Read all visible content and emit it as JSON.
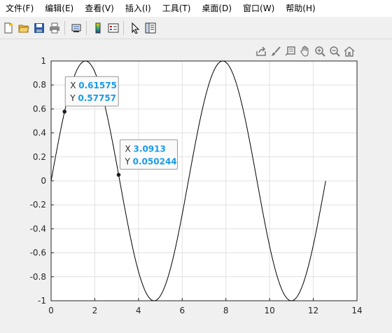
{
  "menu": {
    "items": [
      "文件(F)",
      "编辑(E)",
      "查看(V)",
      "插入(I)",
      "工具(T)",
      "桌面(D)",
      "窗口(W)",
      "帮助(H)"
    ]
  },
  "toolbar": {
    "buttons": [
      "new-file-icon",
      "open-folder-icon",
      "save-icon",
      "print-icon",
      "link-plot-icon",
      "colorbar-icon",
      "legend-icon",
      "pointer-icon",
      "property-inspector-icon"
    ]
  },
  "axes_toolbar": {
    "buttons": [
      "export-icon",
      "brush-icon",
      "data-tips-icon",
      "pan-icon",
      "zoom-in-icon",
      "zoom-out-icon",
      "home-icon"
    ]
  },
  "chart_data": {
    "type": "line",
    "function": "sin(x)",
    "x_range": [
      0,
      12.566
    ],
    "xlim": [
      0,
      14
    ],
    "ylim": [
      -1,
      1
    ],
    "xticks": [
      "0",
      "2",
      "4",
      "6",
      "8",
      "10",
      "12",
      "14"
    ],
    "yticks": [
      "1",
      "0.8",
      "0.6",
      "0.4",
      "0.2",
      "0",
      "-0.2",
      "-0.4",
      "-0.6",
      "-0.8",
      "-1"
    ],
    "grid": true,
    "line_color": "#000000",
    "datatips": [
      {
        "x_label": "X",
        "x_value": "0.61575",
        "y_label": "Y",
        "y_value": "0.57757",
        "x": 0.61575,
        "y": 0.57757
      },
      {
        "x_label": "X",
        "x_value": "3.0913",
        "y_label": "Y",
        "y_value": "0.050244",
        "x": 3.0913,
        "y": 0.050244
      }
    ]
  },
  "colors": {
    "datatip_value": "#1a9be8",
    "axes_bg": "#ffffff",
    "figure_bg": "#f0f0f0"
  }
}
